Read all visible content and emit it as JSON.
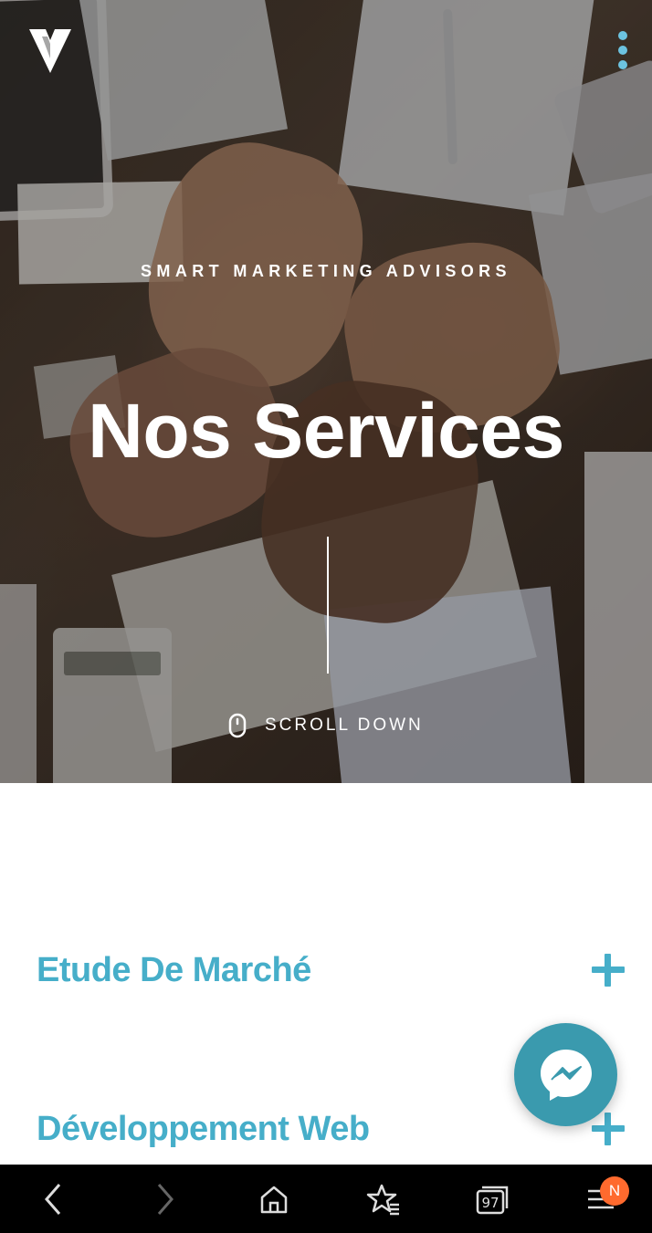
{
  "hero": {
    "kicker": "SMART MARKETING ADVISORS",
    "title": "Nos Services",
    "scroll_label": "SCROLL DOWN"
  },
  "services": [
    {
      "title": "Etude De Marché"
    },
    {
      "title": "Développement Web"
    }
  ],
  "browser_bar": {
    "tab_count": "97",
    "notification_badge": "N"
  },
  "colors": {
    "accent": "#46aec9",
    "menu_dots": "#6cc3e0",
    "messenger_bg": "#3a9aae",
    "badge": "#ff6a2e",
    "navbar_bg": "#000000"
  },
  "icons": [
    "logo-v-icon",
    "menu-dots-icon",
    "mouse-icon",
    "plus-icon",
    "messenger-icon",
    "back-icon",
    "forward-icon",
    "home-icon",
    "bookmarks-icon",
    "tabs-icon",
    "menu-icon"
  ]
}
